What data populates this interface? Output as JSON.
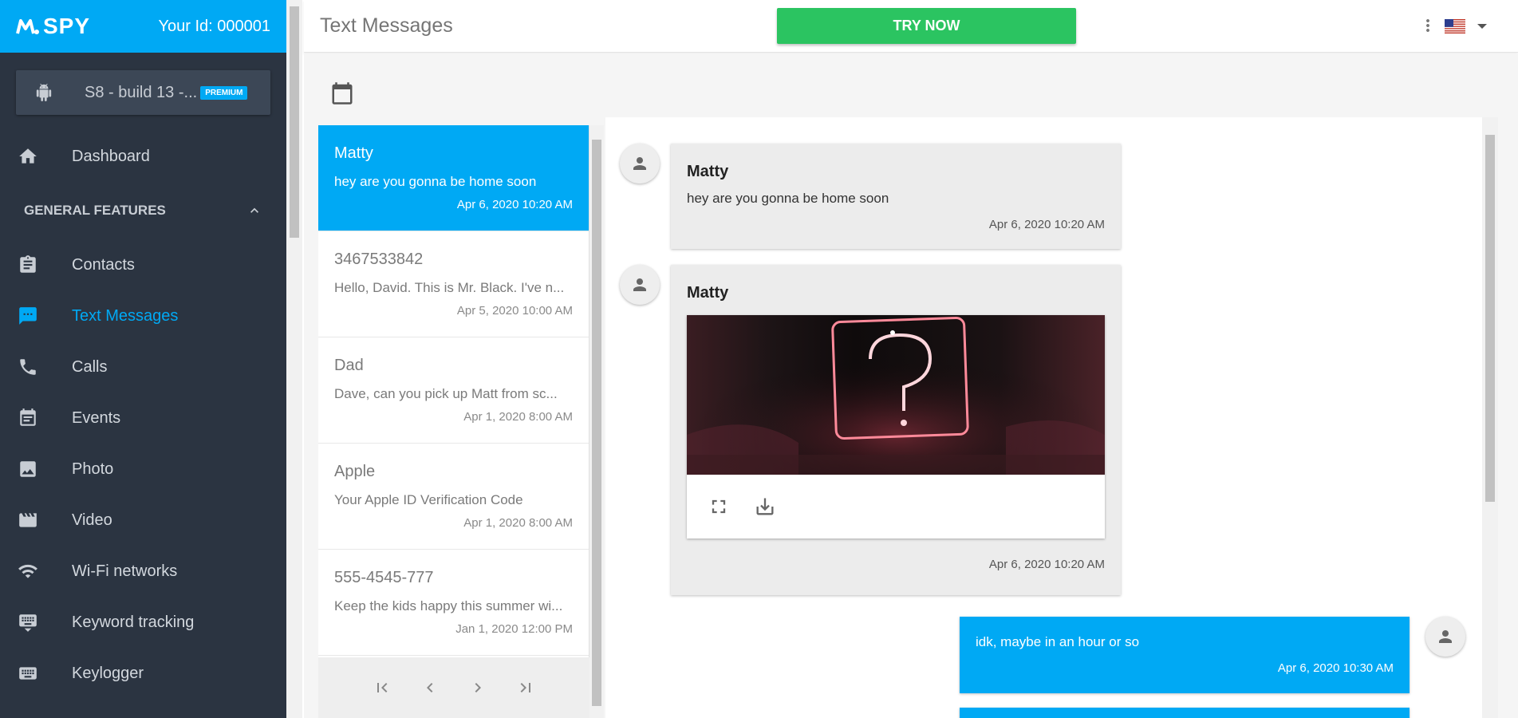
{
  "sidebar": {
    "logo_text": "SPY",
    "your_id": "Your Id: 000001",
    "device": {
      "name": "S8 - build 13 -...",
      "badge": "PREMIUM"
    },
    "dashboard_label": "Dashboard",
    "section_title": "GENERAL FEATURES",
    "items": [
      {
        "label": "Contacts",
        "icon": "clipboard-icon"
      },
      {
        "label": "Text Messages",
        "icon": "message-icon",
        "active": true
      },
      {
        "label": "Calls",
        "icon": "phone-icon"
      },
      {
        "label": "Events",
        "icon": "calendar-icon"
      },
      {
        "label": "Photo",
        "icon": "image-icon"
      },
      {
        "label": "Video",
        "icon": "clapper-icon"
      },
      {
        "label": "Wi-Fi networks",
        "icon": "wifi-icon"
      },
      {
        "label": "Keyword tracking",
        "icon": "keyboard-icon"
      },
      {
        "label": "Keylogger",
        "icon": "keyboard-icon"
      }
    ]
  },
  "topbar": {
    "title": "Text Messages",
    "try_now": "TRY NOW"
  },
  "conversations": [
    {
      "name": "Matty",
      "snippet": "hey are you gonna be home soon",
      "date": "Apr 6, 2020 10:20 AM"
    },
    {
      "name": "3467533842",
      "snippet": "Hello, David. This is Mr. Black. I've n...",
      "date": "Apr 5, 2020 10:00 AM"
    },
    {
      "name": "Dad",
      "snippet": "Dave, can you pick up Matt from sc...",
      "date": "Apr 1, 2020 8:00 AM"
    },
    {
      "name": "Apple",
      "snippet": "Your Apple ID Verification Code",
      "date": "Apr 1, 2020 8:00 AM"
    },
    {
      "name": "555-4545-777",
      "snippet": "Keep the kids happy this summer wi...",
      "date": "Jan 1, 2020 12:00 PM"
    }
  ],
  "messages": [
    {
      "sender": "Matty",
      "text": "hey are you gonna be home soon",
      "date": "Apr 6, 2020 10:20 AM"
    },
    {
      "sender": "Matty",
      "date": "Apr 6, 2020 10:20 AM"
    },
    {
      "text": "idk, maybe in an hour or so",
      "date": "Apr 6, 2020 10:30 AM"
    }
  ],
  "colors": {
    "accent": "#00a9f4",
    "sidebar": "#2b3441",
    "try_now": "#2bc461"
  }
}
